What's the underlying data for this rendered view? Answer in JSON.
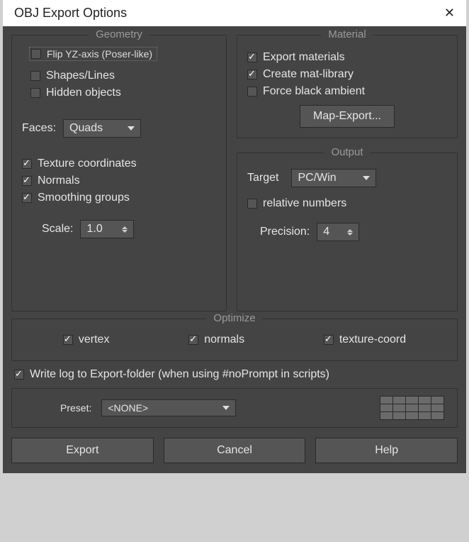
{
  "title": "OBJ Export Options",
  "geometry": {
    "legend": "Geometry",
    "flip_yz": "Flip YZ-axis (Poser-like)",
    "shapes_lines": "Shapes/Lines",
    "hidden_objects": "Hidden objects",
    "faces_label": "Faces:",
    "faces_value": "Quads",
    "tex_coords": "Texture coordinates",
    "normals": "Normals",
    "smoothing": "Smoothing groups",
    "scale_label": "Scale:",
    "scale_value": "1.0"
  },
  "material": {
    "legend": "Material",
    "export_materials": "Export materials",
    "create_matlib": "Create mat-library",
    "force_black": "Force black ambient",
    "map_export_btn": "Map-Export..."
  },
  "output": {
    "legend": "Output",
    "target_label": "Target",
    "target_value": "PC/Win",
    "relative_numbers": "relative numbers",
    "precision_label": "Precision:",
    "precision_value": "4"
  },
  "optimize": {
    "legend": "Optimize",
    "vertex": "vertex",
    "normals": "normals",
    "texcoord": "texture-coord"
  },
  "log_line": "Write log to Export-folder (when using #noPrompt in scripts)",
  "preset": {
    "label": "Preset:",
    "value": "<NONE>"
  },
  "actions": {
    "export": "Export",
    "cancel": "Cancel",
    "help": "Help"
  }
}
